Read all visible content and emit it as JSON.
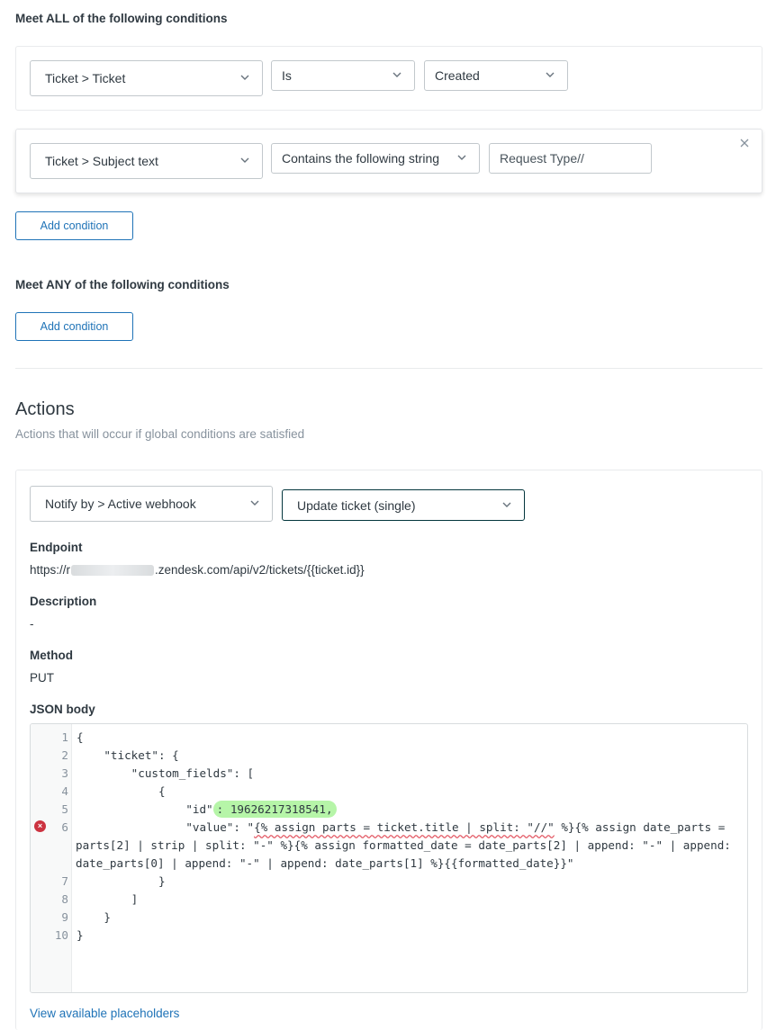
{
  "all_conditions": {
    "title": "Meet ALL of the following conditions",
    "rows": [
      {
        "field": "Ticket > Ticket",
        "operator": "Is",
        "value": "Created"
      },
      {
        "field": "Ticket > Subject text",
        "operator": "Contains the following string",
        "value": "Request Type//"
      }
    ],
    "add_label": "Add condition",
    "remove_icon": "close-icon"
  },
  "any_conditions": {
    "title": "Meet ANY of the following conditions",
    "add_label": "Add condition"
  },
  "actions": {
    "title": "Actions",
    "subtitle": "Actions that will occur if global conditions are satisfied",
    "action_type": "Notify by > Active webhook",
    "webhook": "Update ticket (single)",
    "endpoint_label": "Endpoint",
    "endpoint_prefix": "https://r",
    "endpoint_suffix": ".zendesk.com/api/v2/tickets/{{ticket.id}}",
    "description_label": "Description",
    "description_value": "-",
    "method_label": "Method",
    "method_value": "PUT",
    "json_label": "JSON body",
    "placeholders_link": "View available placeholders"
  },
  "editor": {
    "line_numbers": [
      "1",
      "2",
      "3",
      "4",
      "5",
      "6",
      "7",
      "8",
      "9",
      "10"
    ],
    "lines": {
      "l1": "{",
      "l2": "    \"ticket\": {",
      "l3": "        \"custom_fields\": [",
      "l4": "            {",
      "l5_key": "                \"id\"",
      "l5_val": ": 19626217318541,",
      "l6a_pre": "                \"value\": \"",
      "l6a_sq": "{% assign parts = ticket.title | split: \"//\"",
      "l6a_post": " %}{% assign date_parts =",
      "l6b": "parts[2] | strip | split: \"-\" %}{% assign formatted_date = date_parts[2] | append: \"-\" | append:",
      "l6c": "date_parts[0] | append: \"-\" | append: date_parts[1] %}{{formatted_date}}\"",
      "l7": "            }",
      "l8": "        ]",
      "l9": "    }",
      "l10": "}"
    },
    "error_icon": "error-icon"
  },
  "colors": {
    "accent": "#1f73b7",
    "highlight": "#b6f5a8",
    "error": "#cc3340"
  }
}
